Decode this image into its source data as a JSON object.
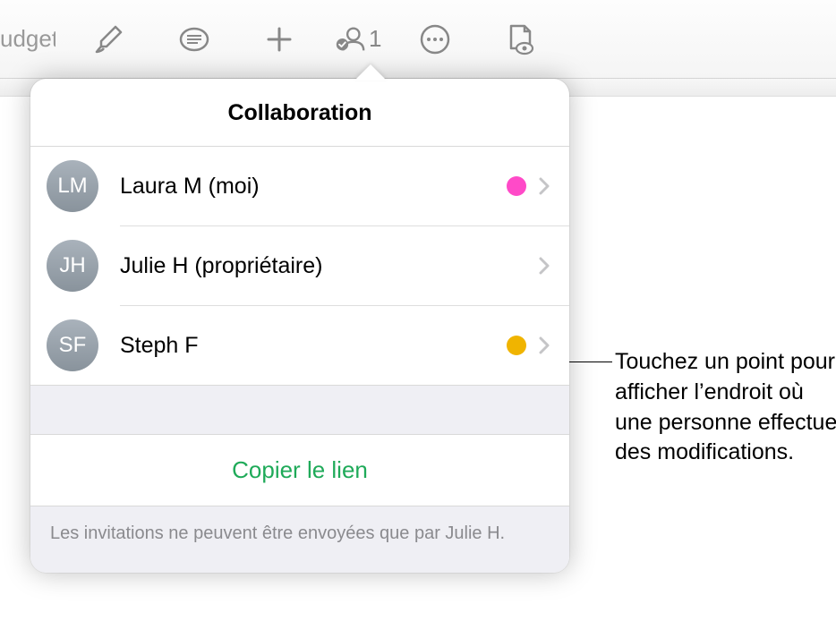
{
  "toolbar": {
    "title_cut": "udget",
    "collab_count": "1"
  },
  "popover": {
    "title": "Collaboration",
    "participants": [
      {
        "initials": "LM",
        "name": "Laura M (moi)",
        "dot_color": "#ff4ac8",
        "show_dot": true
      },
      {
        "initials": "JH",
        "name": "Julie H (propriétaire)",
        "dot_color": "",
        "show_dot": false
      },
      {
        "initials": "SF",
        "name": "Steph F",
        "dot_color": "#f0b400",
        "show_dot": true
      }
    ],
    "copy_link": "Copier le lien",
    "footer": "Les invitations ne peuvent être envoyées que par Julie H."
  },
  "annotation": "Touchez un point pour afficher l’endroit où une personne effectue des modifications."
}
